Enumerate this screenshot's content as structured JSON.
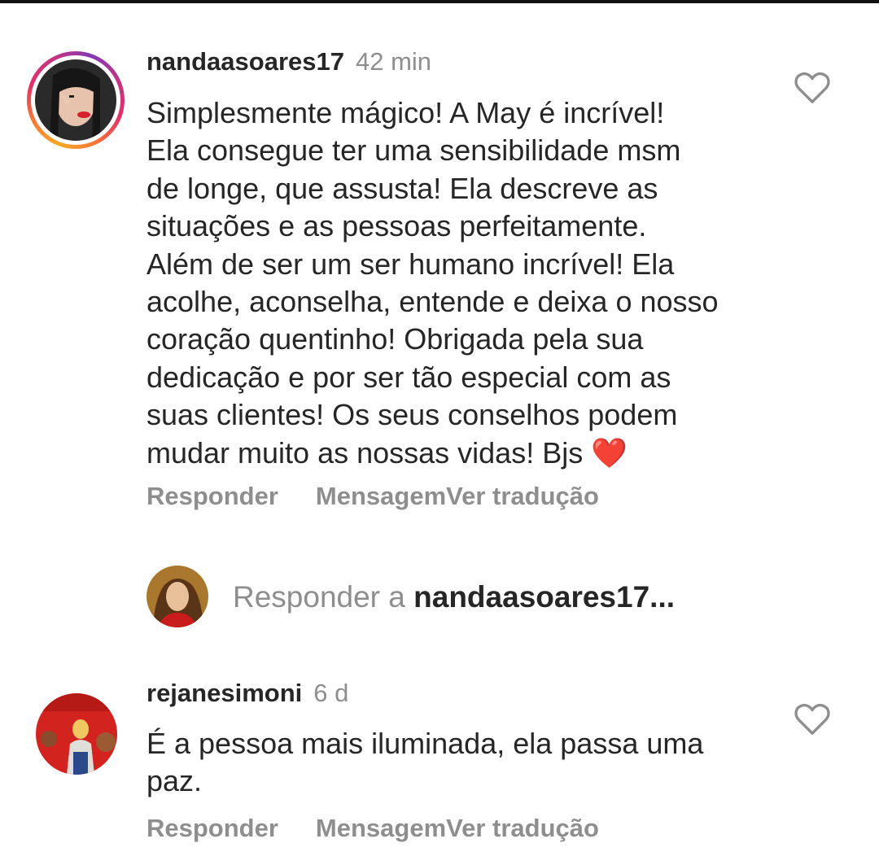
{
  "comments": [
    {
      "username": "nandaasoares17",
      "time": "42 min",
      "text": "Simplesmente mágico! A May é incrível!\nEla consegue ter uma sensibilidade msm\nde longe, que assusta! Ela descreve as\nsituações e as pessoas perfeitamente.\nAlém de ser um ser humano incrível! Ela\nacolhe, aconselha, entende e deixa o nosso\ncoração quentinho! Obrigada pela sua\ndedicação e por ser tão especial com as\nsuas clientes! Os seus conselhos podem\nmudar muito as nossas vidas! Bjs ❤️",
      "reply_label": "Responder",
      "message_label": "Mensagem",
      "translate_label": "Ver tradução"
    },
    {
      "username": "rejanesimoni",
      "time": "6 d",
      "text": "É a pessoa mais iluminada, ela passa uma\npaz.",
      "reply_label": "Responder",
      "message_label": "Mensagem",
      "translate_label": "Ver tradução"
    }
  ],
  "reply_box": {
    "prefix": "Responder a ",
    "username": "nandaasoares17..."
  },
  "colors": {
    "text": "#262626",
    "secondary": "#8e8e8e",
    "heart_red": "#e0282e"
  },
  "icons": {
    "like": "heart-outline-icon"
  }
}
